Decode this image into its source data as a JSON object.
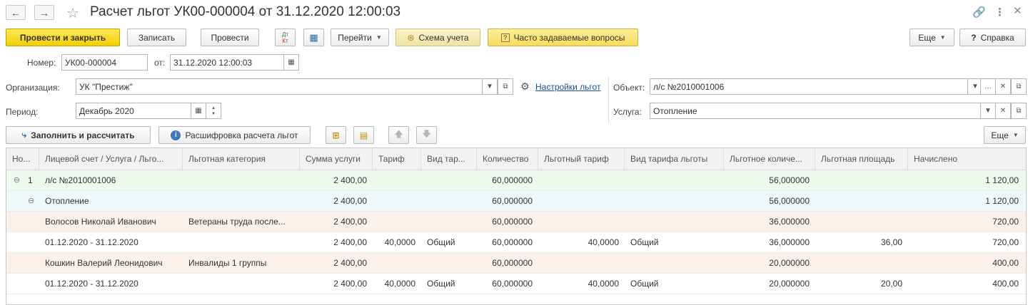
{
  "window": {
    "title": "Расчет льгот УК00-000004 от 31.12.2020 12:00:03"
  },
  "toolbar": {
    "post_close": "Провести и закрыть",
    "save": "Записать",
    "post": "Провести",
    "dt_kt_icon_top": "Дт",
    "dt_kt_icon_bottom": "Кт",
    "goto": "Перейти",
    "scheme": "Схема учета",
    "faq": "Часто задаваемые вопросы",
    "more": "Еще",
    "help": "Справка"
  },
  "header": {
    "number_label": "Номер:",
    "number_value": "УК00-000004",
    "date_label": "от:",
    "date_value": "31.12.2020 12:00:03",
    "org_label": "Организация:",
    "org_value": "УК \"Престиж\"",
    "settings_link": "Настройки льгот",
    "object_label": "Объект:",
    "object_value": "л/с №2010001006",
    "period_label": "Период:",
    "period_value": "Декабрь 2020",
    "service_label": "Услуга:",
    "service_value": "Отопление"
  },
  "table_toolbar": {
    "fill": "Заполнить и рассчитать",
    "explain": "Расшифровка расчета льгот",
    "more": "Еще"
  },
  "table": {
    "columns": [
      "Но...",
      "Лицевой счет / Услуга / Льго...",
      "Льготная категория",
      "Сумма услуги",
      "Тариф",
      "Вид тар...",
      "Количество",
      "Льготный тариф",
      "Вид тарифа льготы",
      "Льготное количе...",
      "Льготная площадь",
      "Начислено"
    ],
    "rows": [
      {
        "num": "1",
        "name": "л/с №2010001006",
        "category": "",
        "sum": "2 400,00",
        "tariff": "",
        "tariff_type": "",
        "qty": "60,000000",
        "lg_tariff": "",
        "lg_tariff_type": "",
        "lg_qty": "56,000000",
        "lg_area": "",
        "charged": "1 120,00"
      },
      {
        "num": "",
        "name": "Отопление",
        "category": "",
        "sum": "2 400,00",
        "tariff": "",
        "tariff_type": "",
        "qty": "60,000000",
        "lg_tariff": "",
        "lg_tariff_type": "",
        "lg_qty": "56,000000",
        "lg_area": "",
        "charged": "1 120,00"
      },
      {
        "num": "",
        "name": "Волосов Николай Иванович",
        "category": "Ветераны труда после...",
        "sum": "2 400,00",
        "tariff": "",
        "tariff_type": "",
        "qty": "60,000000",
        "lg_tariff": "",
        "lg_tariff_type": "",
        "lg_qty": "36,000000",
        "lg_area": "",
        "charged": "720,00"
      },
      {
        "num": "",
        "name": "01.12.2020 - 31.12.2020",
        "category": "",
        "sum": "2 400,00",
        "tariff": "40,0000",
        "tariff_type": "Общий",
        "qty": "60,000000",
        "lg_tariff": "40,0000",
        "lg_tariff_type": "Общий",
        "lg_qty": "36,000000",
        "lg_area": "36,00",
        "charged": "720,00"
      },
      {
        "num": "",
        "name": "Кошкин Валерий Леонидович",
        "category": "Инвалиды 1 группы",
        "sum": "2 400,00",
        "tariff": "",
        "tariff_type": "",
        "qty": "60,000000",
        "lg_tariff": "",
        "lg_tariff_type": "",
        "lg_qty": "20,000000",
        "lg_area": "",
        "charged": "400,00"
      },
      {
        "num": "",
        "name": "01.12.2020 - 31.12.2020",
        "category": "",
        "sum": "2 400,00",
        "tariff": "40,0000",
        "tariff_type": "Общий",
        "qty": "60,000000",
        "lg_tariff": "40,0000",
        "lg_tariff_type": "Общий",
        "lg_qty": "20,000000",
        "lg_area": "20,00",
        "charged": "400,00"
      }
    ]
  },
  "colors": {
    "row_account": "#eefaee",
    "row_service": "#eefaf9",
    "row_person": "#fcf1ea",
    "row_period": "#ffffff",
    "primary_button": "#f2cf00",
    "link": "#1a4fa0"
  }
}
